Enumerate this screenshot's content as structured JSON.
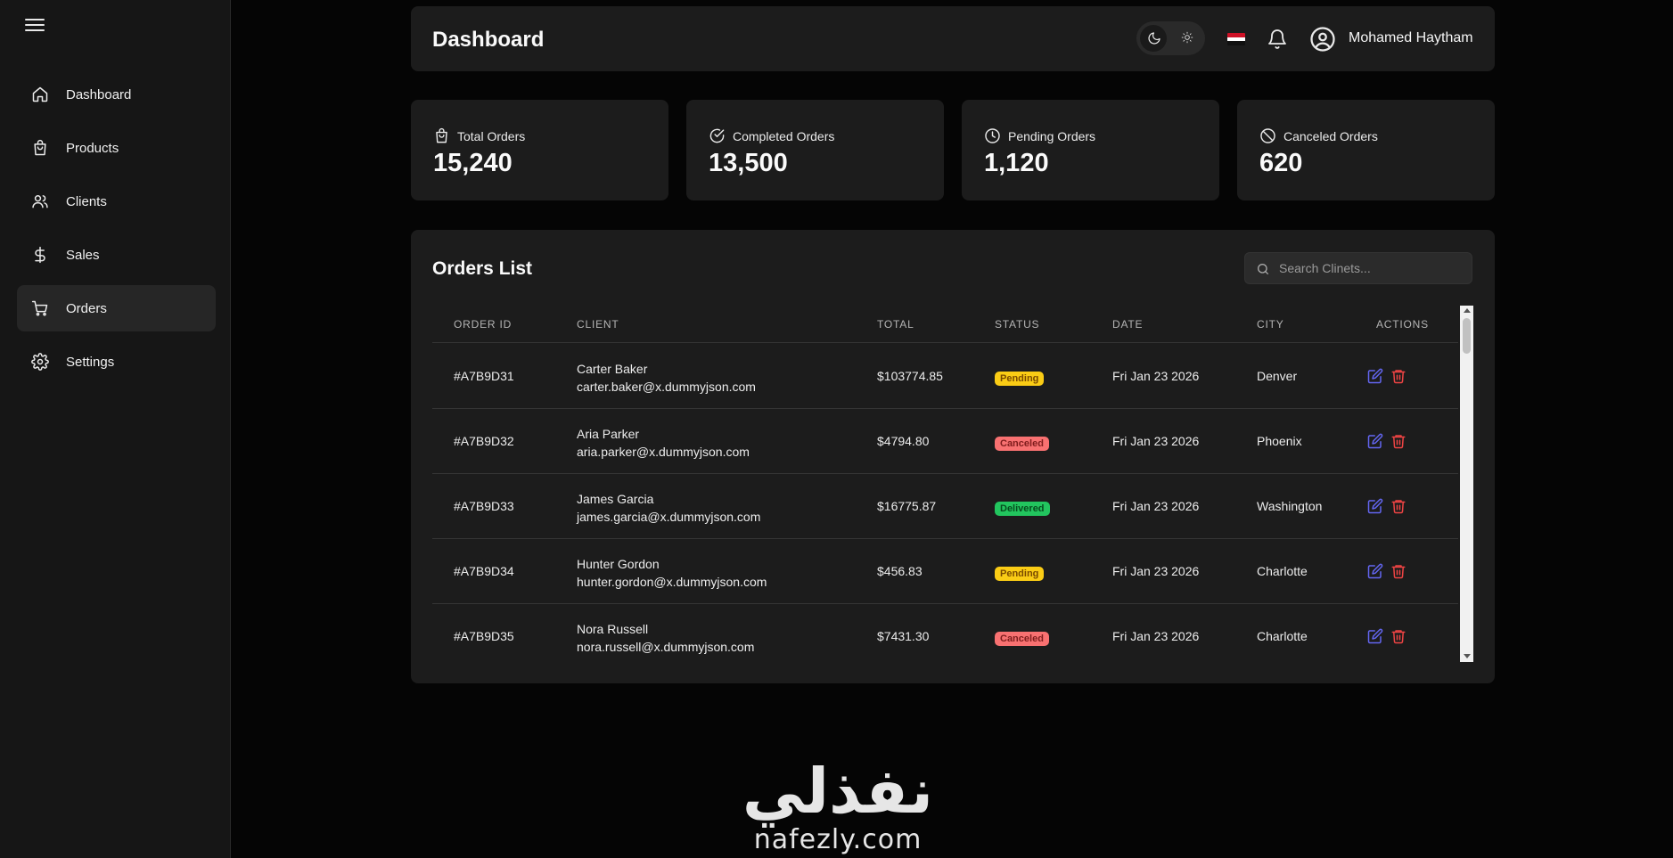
{
  "sidebar": {
    "items": [
      {
        "label": "Dashboard",
        "icon": "home-icon"
      },
      {
        "label": "Products",
        "icon": "shopping-bag-icon"
      },
      {
        "label": "Clients",
        "icon": "users-icon"
      },
      {
        "label": "Sales",
        "icon": "dollar-icon"
      },
      {
        "label": "Orders",
        "icon": "cart-icon",
        "active": true
      },
      {
        "label": "Settings",
        "icon": "gear-icon"
      }
    ]
  },
  "header": {
    "title": "Dashboard",
    "user_name": "Mohamed Haytham",
    "language_flag": "egypt-flag-icon"
  },
  "stats": [
    {
      "label": "Total Orders",
      "value": "15,240",
      "icon": "shopping-bag-icon"
    },
    {
      "label": "Completed Orders",
      "value": "13,500",
      "icon": "check-circle-icon"
    },
    {
      "label": "Pending Orders",
      "value": "1,120",
      "icon": "clock-icon"
    },
    {
      "label": "Canceled Orders",
      "value": "620",
      "icon": "ban-icon"
    }
  ],
  "orders": {
    "title": "Orders List",
    "search_placeholder": "Search Clinets...",
    "columns": [
      "ORDER ID",
      "CLIENT",
      "TOTAL",
      "STATUS",
      "DATE",
      "CITY",
      "ACTIONS"
    ],
    "rows": [
      {
        "id": "#A7B9D31",
        "name": "Carter Baker",
        "email": "carter.baker@x.dummyjson.com",
        "total": "$103774.85",
        "status": "Pending",
        "date": "Fri Jan 23 2026",
        "city": "Denver"
      },
      {
        "id": "#A7B9D32",
        "name": "Aria Parker",
        "email": "aria.parker@x.dummyjson.com",
        "total": "$4794.80",
        "status": "Canceled",
        "date": "Fri Jan 23 2026",
        "city": "Phoenix"
      },
      {
        "id": "#A7B9D33",
        "name": "James Garcia",
        "email": "james.garcia@x.dummyjson.com",
        "total": "$16775.87",
        "status": "Delivered",
        "date": "Fri Jan 23 2026",
        "city": "Washington"
      },
      {
        "id": "#A7B9D34",
        "name": "Hunter Gordon",
        "email": "hunter.gordon@x.dummyjson.com",
        "total": "$456.83",
        "status": "Pending",
        "date": "Fri Jan 23 2026",
        "city": "Charlotte"
      },
      {
        "id": "#A7B9D35",
        "name": "Nora Russell",
        "email": "nora.russell@x.dummyjson.com",
        "total": "$7431.30",
        "status": "Canceled",
        "date": "Fri Jan 23 2026",
        "city": "Charlotte"
      }
    ]
  },
  "status_colors": {
    "Pending": {
      "bg": "#facc15",
      "fg": "#7a4b00"
    },
    "Canceled": {
      "bg": "#f87171",
      "fg": "#7f1d1d"
    },
    "Delivered": {
      "bg": "#22c55e",
      "fg": "#064e1f"
    }
  },
  "watermark": {
    "arabic": "نفذلي",
    "latin": "nafezly.com"
  }
}
